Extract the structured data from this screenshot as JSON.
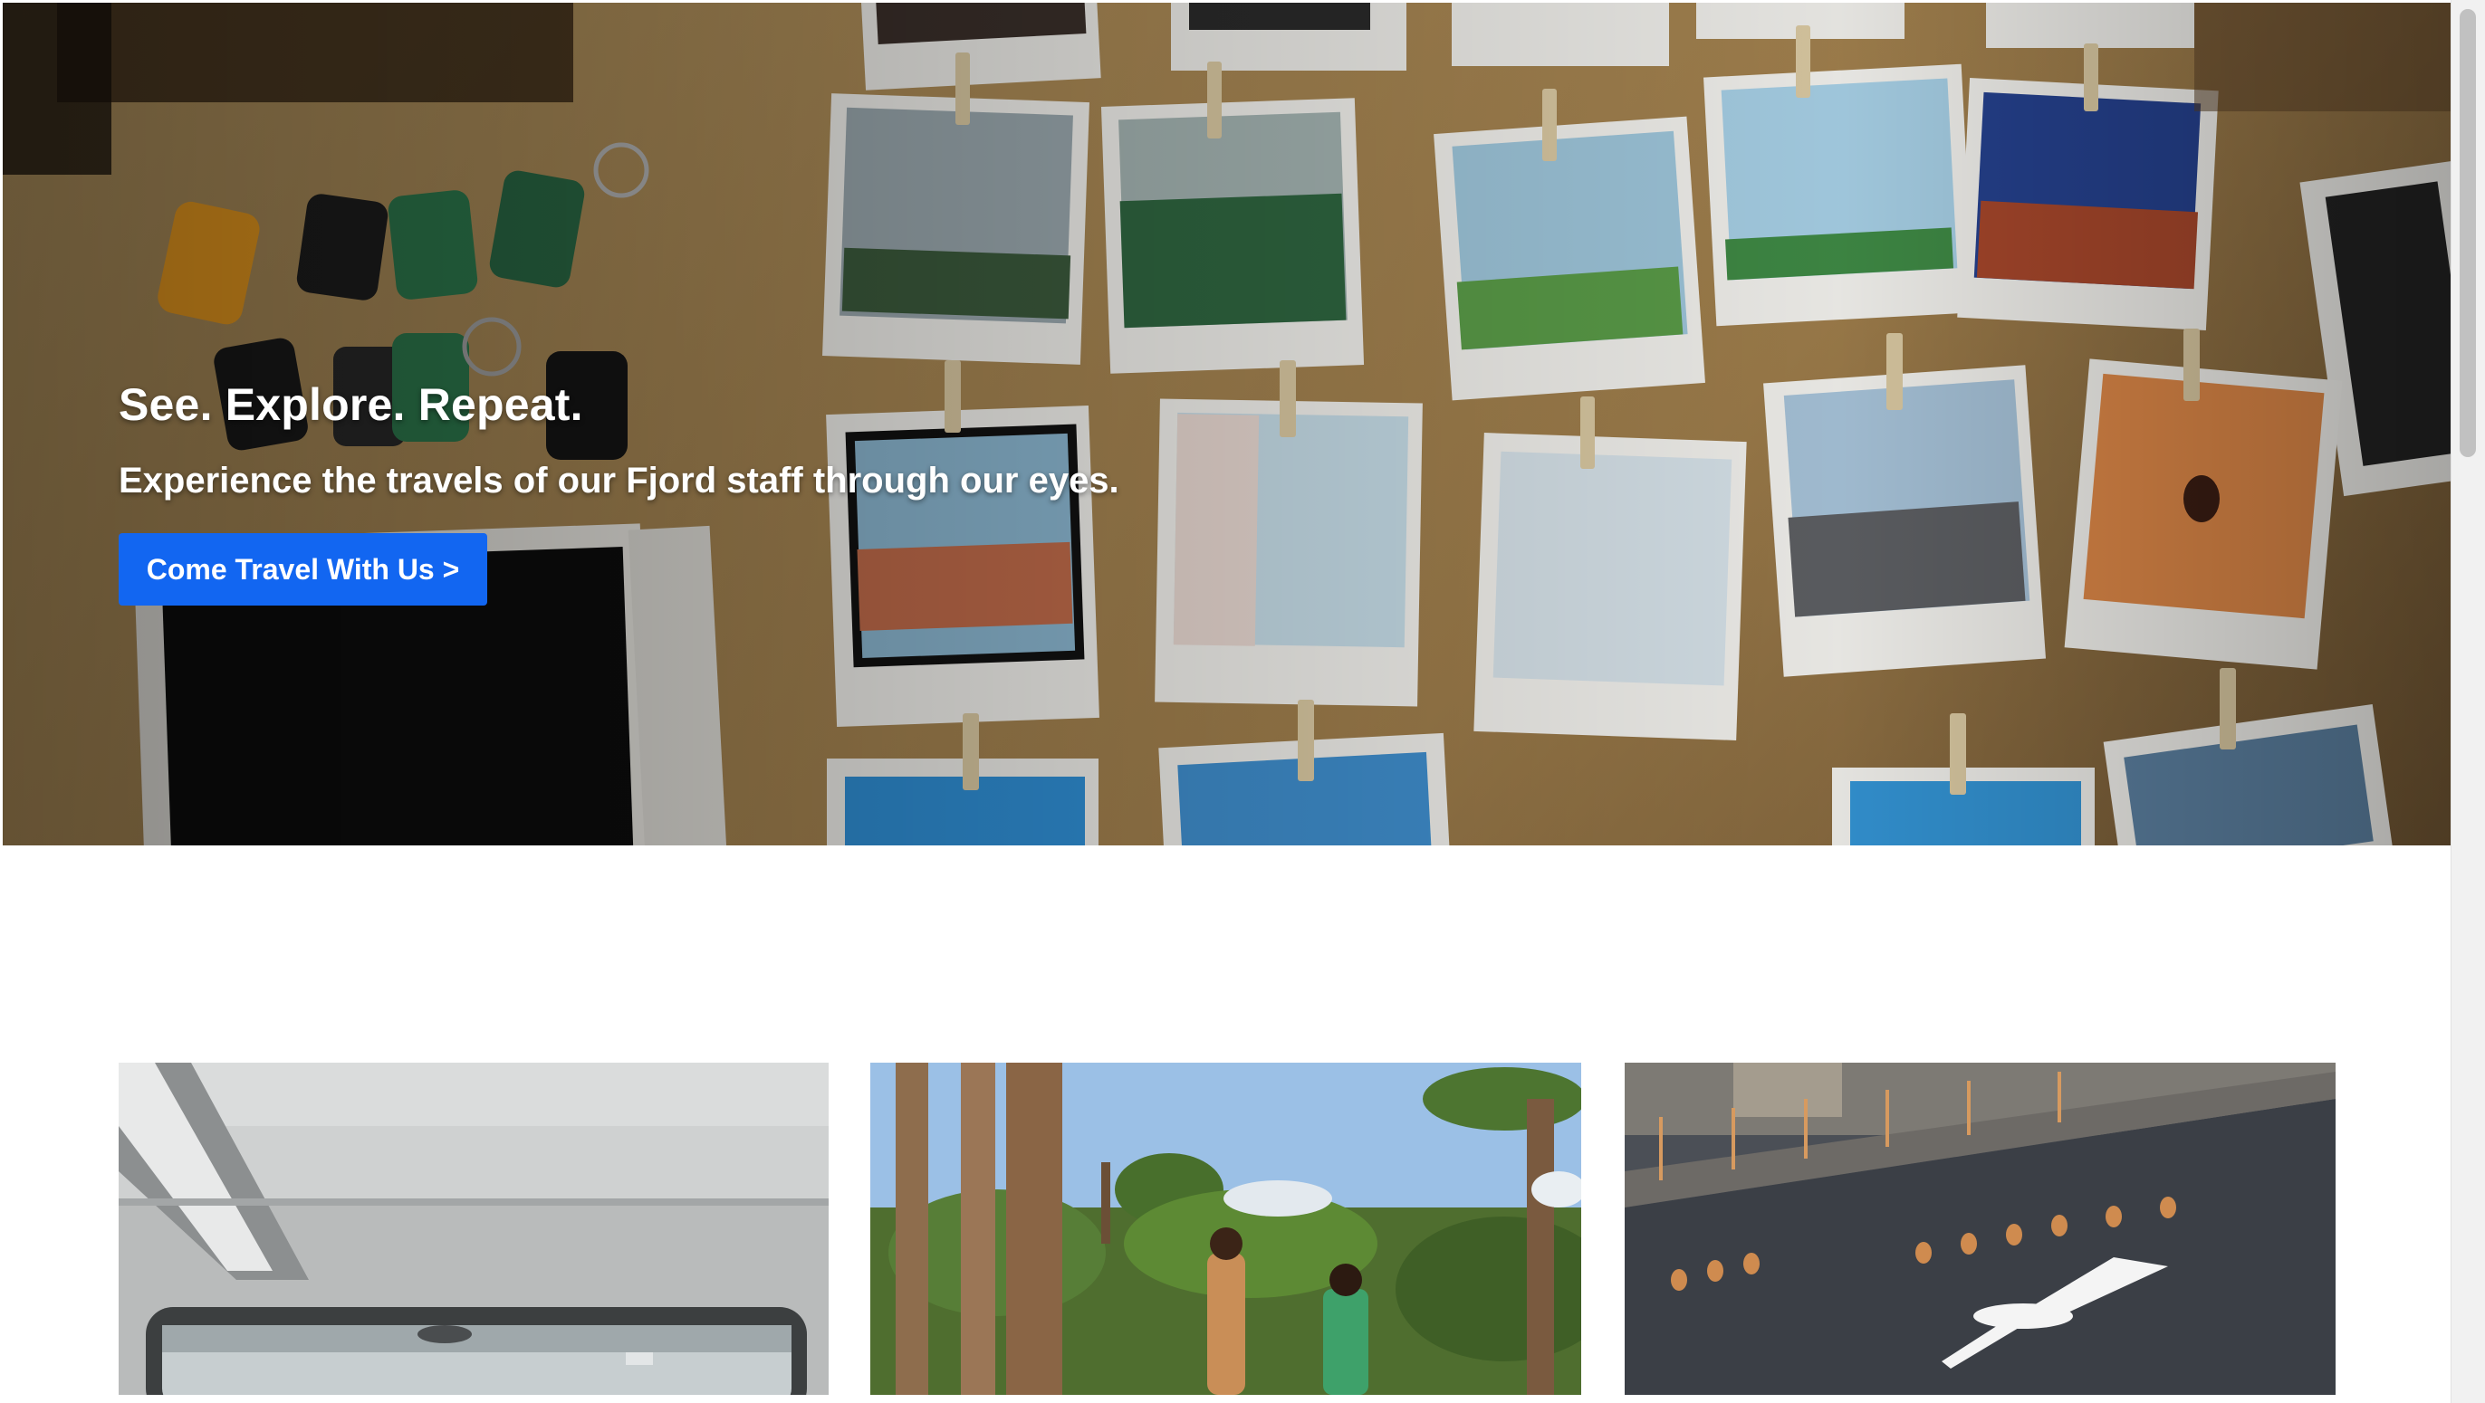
{
  "hero": {
    "title": "See. Explore. Repeat.",
    "subtitle": "Experience the travels of our Fjord staff through our eyes.",
    "cta_label": "Come Travel With Us >"
  },
  "cards": [
    {
      "image": "ferry-window-photo"
    },
    {
      "image": "baobab-women-photo"
    },
    {
      "image": "ship-seagull-photo"
    }
  ],
  "colors": {
    "cta_background": "#1266f1",
    "page_background": "#ffffff"
  }
}
